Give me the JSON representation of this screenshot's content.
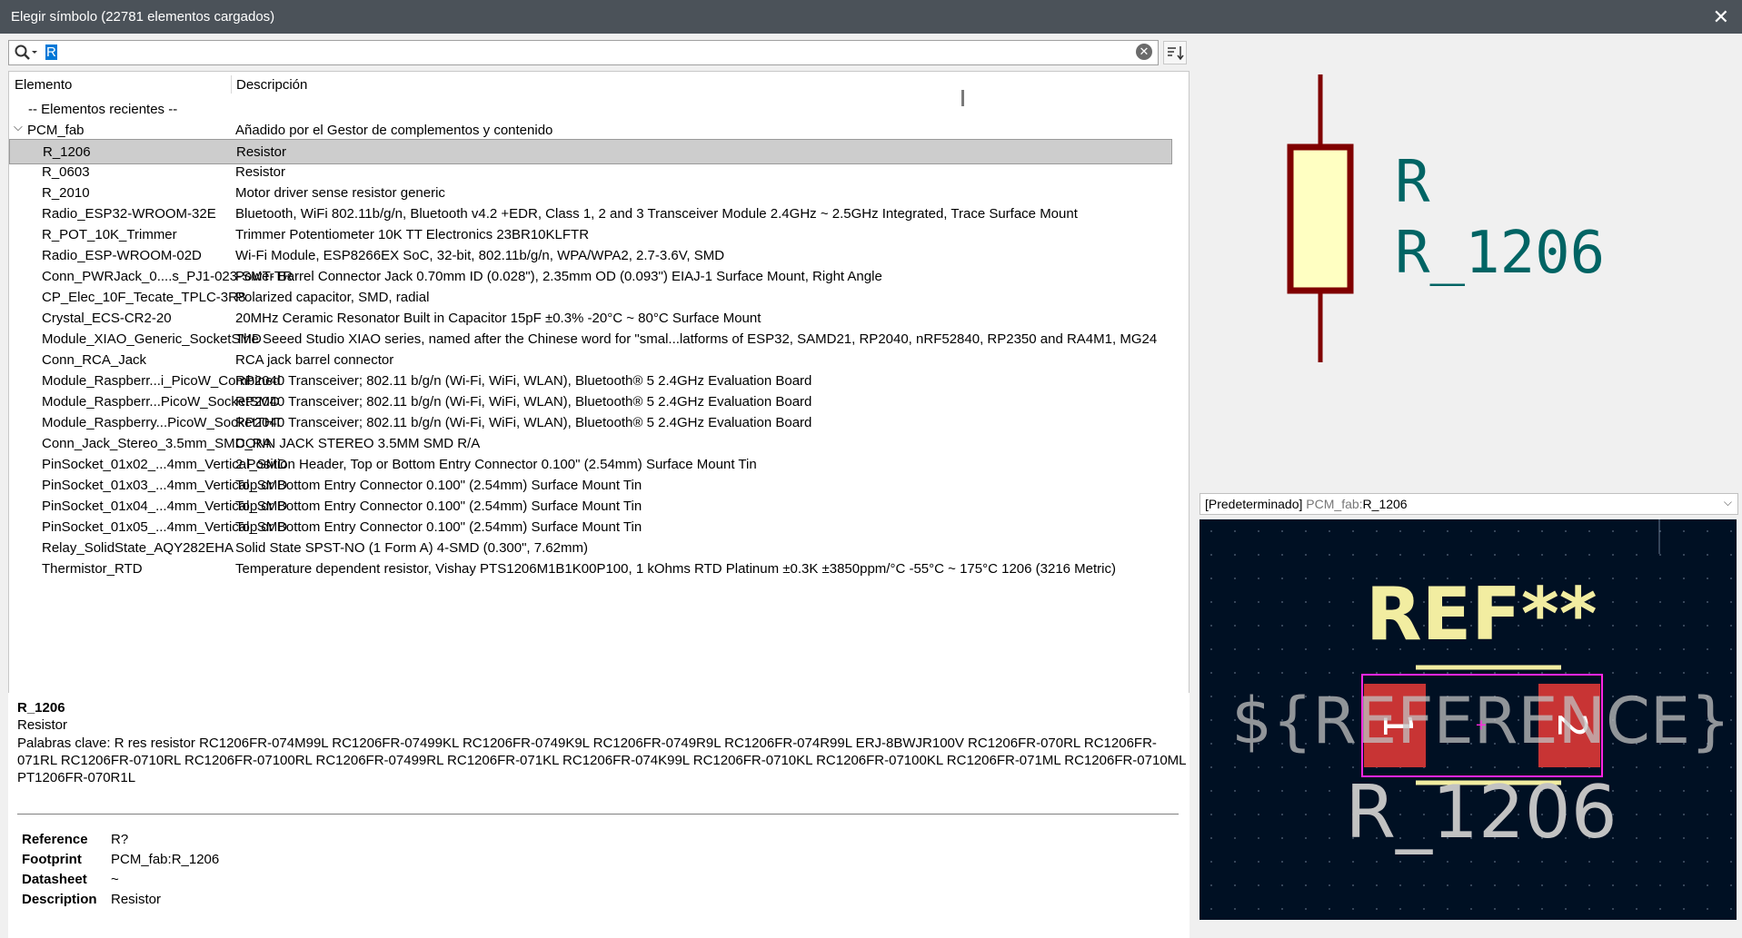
{
  "window": {
    "title": "Elegir símbolo (22781 elementos cargados)"
  },
  "search": {
    "value": "R"
  },
  "columns": {
    "element": "Elemento",
    "description": "Descripción"
  },
  "recent_label": "-- Elementos recientes --",
  "group": {
    "name": "PCM_fab",
    "description": "Añadido por el Gestor de complementos y contenido"
  },
  "rows": [
    {
      "name": "R_1206",
      "desc": "Resistor"
    },
    {
      "name": "R_0603",
      "desc": "Resistor"
    },
    {
      "name": "R_2010",
      "desc": "Motor driver sense resistor generic"
    },
    {
      "name": "Radio_ESP32-WROOM-32E",
      "desc": "Bluetooth, WiFi 802.11b/g/n, Bluetooth v4.2 +EDR, Class 1, 2 and 3 Transceiver Module 2.4GHz ~ 2.5GHz Integrated, Trace Surface Mount"
    },
    {
      "name": "R_POT_10K_Trimmer",
      "desc": "Trimmer Potentiometer 10K TT Electronics 23BR10KLFTR"
    },
    {
      "name": "Radio_ESP-WROOM-02D",
      "desc": "Wi-Fi Module, ESP8266EX SoC, 32-bit, 802.11b/g/n, WPA/WPA2, 2.7-3.6V, SMD"
    },
    {
      "name": "Conn_PWRJack_0....s_PJ1-023-SMT-TR",
      "desc": "Power Barrel Connector Jack 0.70mm ID (0.028\"), 2.35mm OD (0.093\") EIAJ-1 Surface Mount, Right Angle"
    },
    {
      "name": "CP_Elec_10F_Tecate_TPLC-3R8",
      "desc": "Polarized capacitor, SMD, radial"
    },
    {
      "name": "Crystal_ECS-CR2-20",
      "desc": "20MHz Ceramic Resonator Built in Capacitor 15pF ±0.3%  -20°C ~ 80°C Surface Mount"
    },
    {
      "name": "Module_XIAO_Generic_SocketSMD",
      "desc": "The Seeed Studio XIAO series, named after the Chinese word for \"smal...latforms of ESP32, SAMD21, RP2040, nRF52840, RP2350 and RA4M1, MG24"
    },
    {
      "name": "Conn_RCA_Jack",
      "desc": "RCA jack barrel connector"
    },
    {
      "name": "Module_Raspberr...i_PicoW_Combined",
      "desc": "RP2040 Transceiver; 802.11 b/g/n (Wi-Fi, WiFi, WLAN), Bluetooth® 5 2.4GHz Evaluation Board"
    },
    {
      "name": "Module_Raspberr...PicoW_SocketSMD",
      "desc": "RP2040 Transceiver; 802.11 b/g/n (Wi-Fi, WiFi, WLAN), Bluetooth® 5 2.4GHz Evaluation Board"
    },
    {
      "name": "Module_Raspberry...PicoW_SocketTHT",
      "desc": "RP2040 Transceiver; 802.11 b/g/n (Wi-Fi, WiFi, WLAN), Bluetooth® 5 2.4GHz Evaluation Board"
    },
    {
      "name": "Conn_Jack_Stereo_3.5mm_SMD_RA",
      "desc": "CONN JACK STEREO 3.5MM SMD R/A"
    },
    {
      "name": "PinSocket_01x02_...4mm_Vertical_SMD",
      "desc": "2 Position Header, Top or Bottom Entry Connector 0.100\" (2.54mm) Surface Mount Tin"
    },
    {
      "name": "PinSocket_01x03_...4mm_Vertical_SMD",
      "desc": "Top or Bottom Entry Connector 0.100\" (2.54mm) Surface Mount Tin"
    },
    {
      "name": "PinSocket_01x04_...4mm_Vertical_SMD",
      "desc": "Top or Bottom Entry Connector 0.100\" (2.54mm) Surface Mount Tin"
    },
    {
      "name": "PinSocket_01x05_...4mm_Vertical_SMD",
      "desc": "Top or Bottom Entry Connector 0.100\" (2.54mm) Surface Mount Tin"
    },
    {
      "name": "Relay_SolidState_AQY282EHA",
      "desc": "Solid State SPST-NO (1 Form A) 4-SMD (0.300\", 7.62mm)"
    },
    {
      "name": "Thermistor_RTD",
      "desc": "Temperature dependent resistor, Vishay PTS1206M1B1K00P100, 1 kOhms RTD Platinum ±0.3K ±3850ppm/°C -55°C ~ 175°C 1206 (3216 Metric)"
    }
  ],
  "details": {
    "name": "R_1206",
    "description": "Resistor",
    "keywords": "Palabras clave: R res resistor RC1206FR-074M99L RC1206FR-07499KL RC1206FR-0749K9L RC1206FR-0749R9L RC1206FR-074R99L ERJ-8BWJR100V RC1206FR-070RL RC1206FR-071RL RC1206FR-0710RL RC1206FR-07100RL RC1206FR-07499RL RC1206FR-071KL RC1206FR-074K99L RC1206FR-0710KL RC1206FR-07100KL RC1206FR-071ML RC1206FR-0710ML PT1206FR-070R1L",
    "fields": [
      {
        "k": "Reference",
        "v": "R?"
      },
      {
        "k": "Footprint",
        "v": "PCM_fab:R_1206"
      },
      {
        "k": "Datasheet",
        "v": "~"
      },
      {
        "k": "Description",
        "v": "Resistor"
      }
    ]
  },
  "symbol_preview": {
    "ref": "R",
    "value": "R_1206"
  },
  "footprint_select": {
    "prefix": "[Predeterminado]",
    "lib": "PCM_fab:",
    "name": "R_1206"
  },
  "footprint_preview": {
    "ref": "REF**",
    "ref_field": "${REFERENCE}",
    "value": "R_1206",
    "pad1": "1",
    "pad2": "2"
  },
  "colors": {
    "symbol_body": "#800000",
    "symbol_fill": "#ffffc2",
    "symbol_text": "#006464",
    "pcb_bg": "#001023"
  }
}
